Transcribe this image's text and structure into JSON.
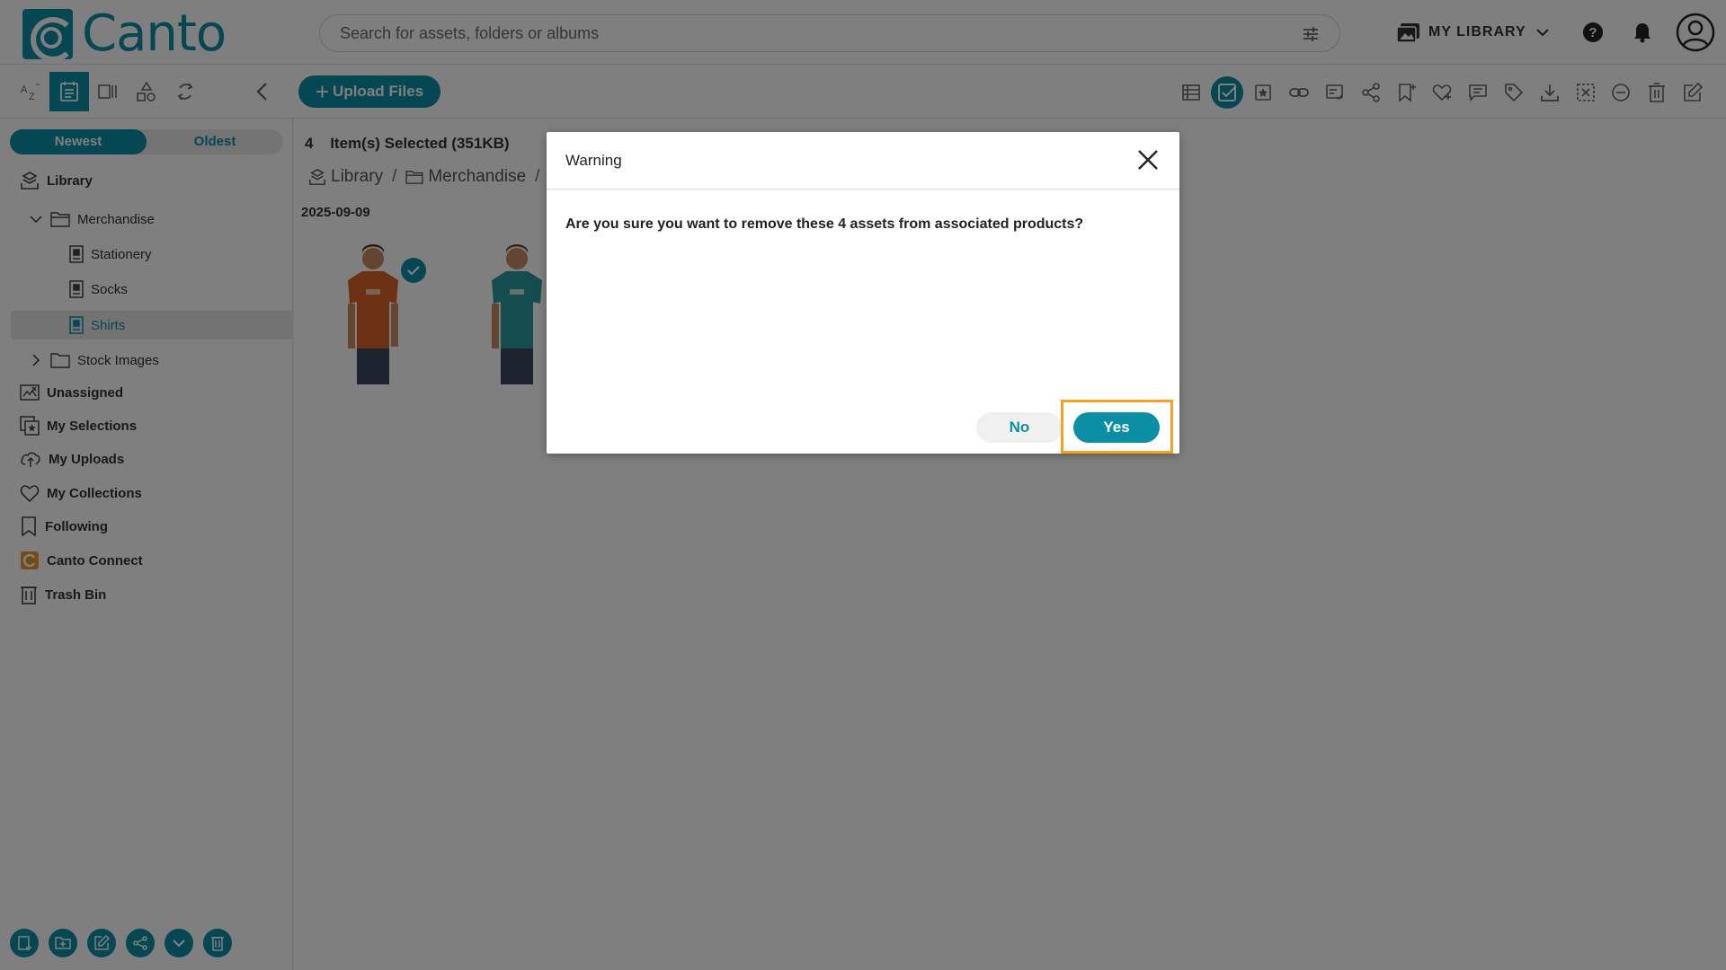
{
  "header": {
    "logo_text": "Canto",
    "search_placeholder": "Search for assets, folders or albums",
    "library_switcher": "MY LIBRARY"
  },
  "toolbar": {
    "upload_label": "Upload Files",
    "view_icons": [
      "sort-az-icon",
      "list-view-icon",
      "gallery-view-icon",
      "shapes-icon",
      "refresh-icon"
    ],
    "action_icons": [
      "table-icon",
      "select-all-icon",
      "add-to-selection-icon",
      "link-icon",
      "approval-icon",
      "share-icon",
      "follow-icon",
      "favorite-icon",
      "comment-icon",
      "tag-icon",
      "download-icon",
      "deselect-icon",
      "remove-icon",
      "trash-icon",
      "edit-icon"
    ]
  },
  "sidebar": {
    "sort_newest": "Newest",
    "sort_oldest": "Oldest",
    "library": "Library",
    "merchandise": "Merchandise",
    "stationery": "Stationery",
    "socks": "Socks",
    "shirts": "Shirts",
    "stock_images": "Stock Images",
    "unassigned": "Unassigned",
    "my_selections": "My Selections",
    "my_uploads": "My Uploads",
    "my_collections": "My Collections",
    "following": "Following",
    "canto_connect": "Canto Connect",
    "trash_bin": "Trash Bin"
  },
  "content": {
    "selected_count": "4",
    "selected_text": "Item(s) Selected (351KB)",
    "breadcrumb": [
      "Library",
      "Merchandise"
    ],
    "date_group": "2025-09-09"
  },
  "modal": {
    "title": "Warning",
    "message": "Are you sure you want to remove these 4 assets from associated products?",
    "no_label": "No",
    "yes_label": "Yes"
  },
  "colors": {
    "accent": "#0a8fa5",
    "highlight": "#f7a21b"
  }
}
